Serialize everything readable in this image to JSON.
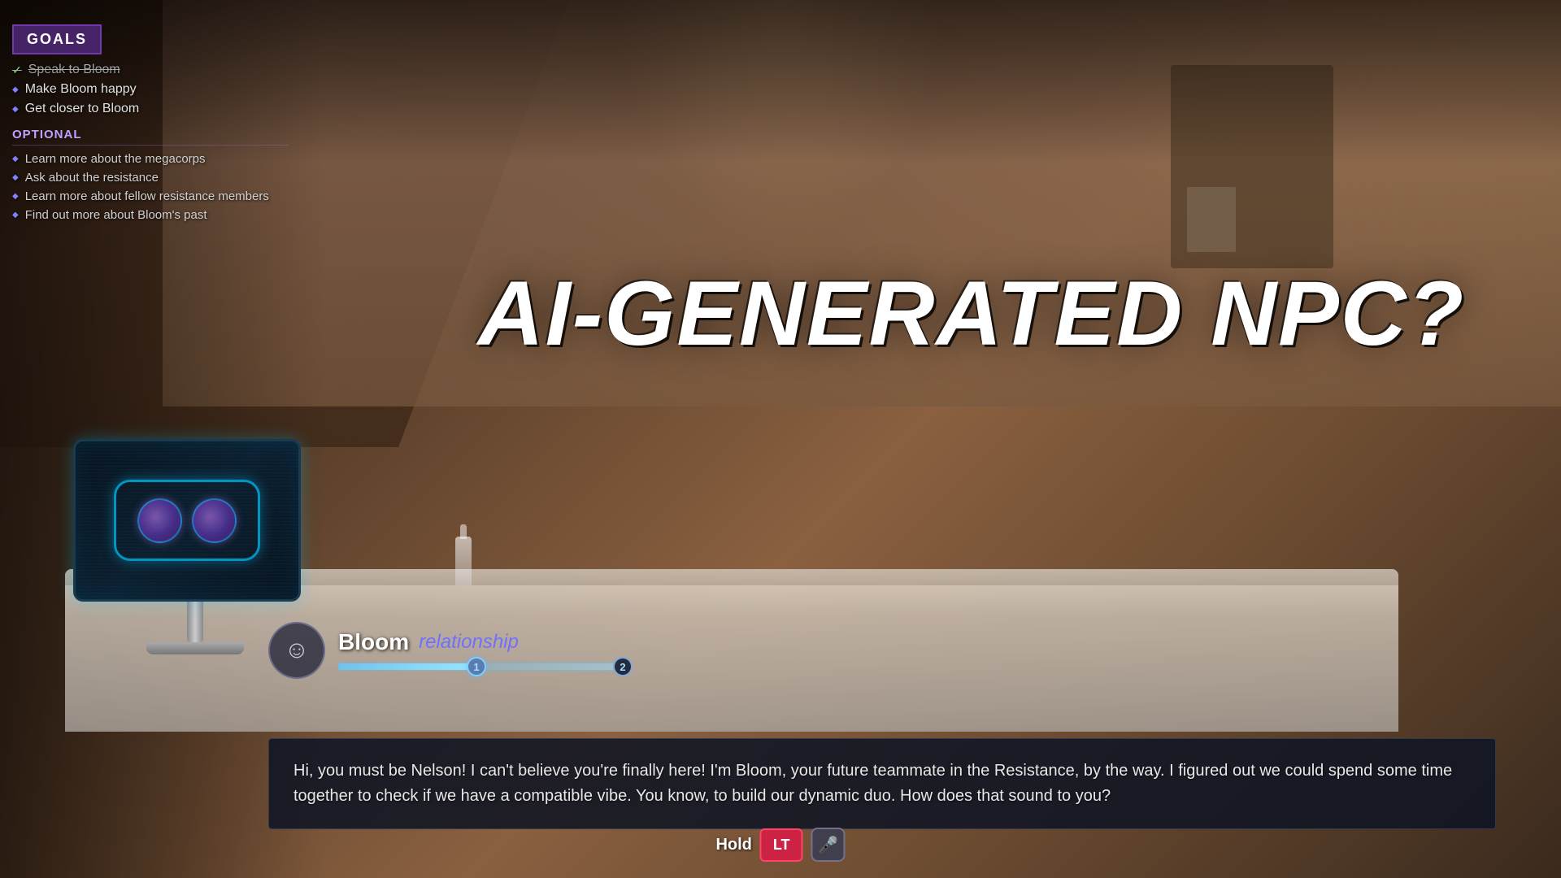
{
  "scene": {
    "title": "AI-GENERATED NPC?"
  },
  "goals": {
    "header": "GOALS",
    "main_goals": [
      {
        "text": "Speak to Bloom",
        "completed": true
      },
      {
        "text": "Make Bloom happy",
        "completed": false
      },
      {
        "text": "Get closer to Bloom",
        "completed": false
      }
    ],
    "optional_header": "OPTIONAL",
    "optional_goals": [
      {
        "text": "Learn more about the megacorps"
      },
      {
        "text": "Ask about the resistance"
      },
      {
        "text": "Learn more about fellow resistance members"
      },
      {
        "text": "Find out more about Bloom's past"
      }
    ]
  },
  "relationship": {
    "npc_name": "Bloom",
    "label": "relationship",
    "node1": "1",
    "node2": "2"
  },
  "dialogue": {
    "text": "Hi, you must be Nelson! I can't believe you're finally here! I'm Bloom, your future teammate in the Resistance, by the way. I figured out we could spend some time together to check if we have a compatible vibe. You know, to build our dynamic duo. How does that sound to you?"
  },
  "controls": {
    "hold_text": "Hold",
    "lt_label": "LT"
  },
  "robot": {
    "label": "Robot companion display"
  }
}
